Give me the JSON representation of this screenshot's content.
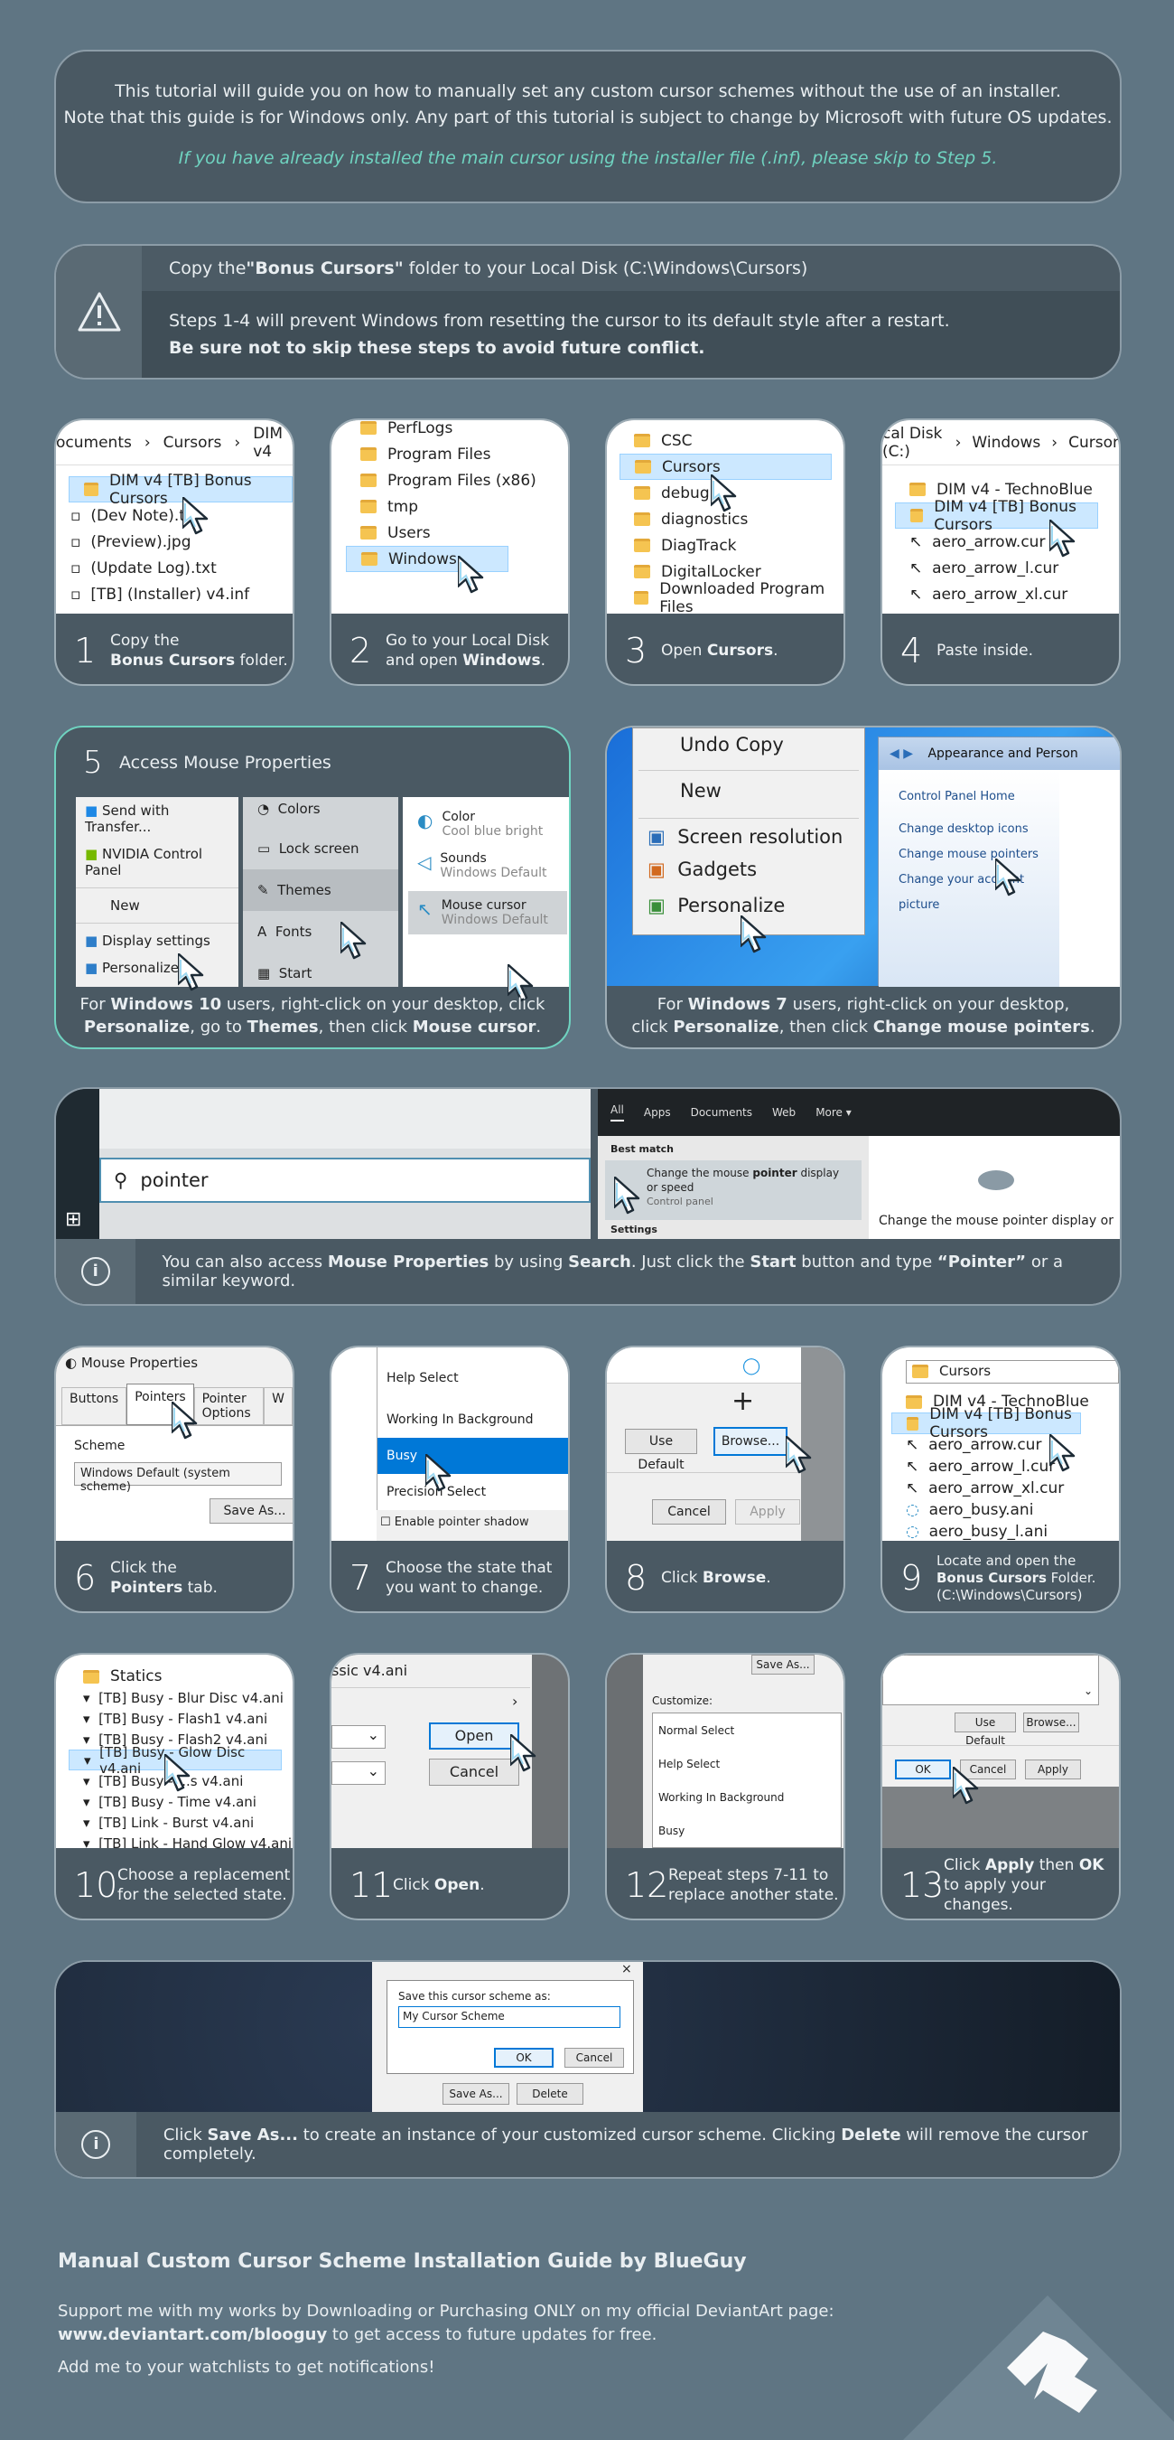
{
  "intro": {
    "line1": "This tutorial will guide you on how to manually set any custom cursor schemes without the use of an installer.",
    "line2": "Note that this guide is for Windows only. Any part of this tutorial is subject to change by Microsoft with future OS updates.",
    "line3": "If you have already installed the main cursor using the installer file (.inf), please skip to Step 5."
  },
  "warning": {
    "pre": "Copy the ",
    "bold": "\"Bonus Cursors\"",
    "post": " folder to your Local Disk (C:\\Windows\\Cursors)",
    "note1": "Steps 1-4 will prevent Windows from resetting the cursor to its default style after a restart.",
    "note2": "Be sure not to skip these steps to avoid future conflict."
  },
  "steps_row1": [
    {
      "num": "1",
      "l1": "Copy the",
      "l2b": "Bonus Cursors",
      "l2": " folder."
    },
    {
      "num": "2",
      "l1": "Go to your Local Disk",
      "l2": "and open ",
      "l2b": "Windows",
      "l2e": "."
    },
    {
      "num": "3",
      "l1": "Open ",
      "l1b": "Cursors",
      "l1e": "."
    },
    {
      "num": "4",
      "l1": "Paste inside."
    }
  ],
  "shot1": {
    "crumbs": [
      "ocuments",
      "Cursors",
      "DIM v4"
    ],
    "items": [
      "DIM v4 [TB] Bonus Cursors",
      "(Dev Note).t",
      "(Preview).jpg",
      "(Update Log).txt",
      "[TB] (Installer) v4.inf"
    ]
  },
  "shot2": {
    "items": [
      "PerfLogs",
      "Program Files",
      "Program Files (x86)",
      "tmp",
      "Users",
      "Windows"
    ]
  },
  "shot3": {
    "items": [
      "CSC",
      "Cursors",
      "debug",
      "diagnostics",
      "DiagTrack",
      "DigitalLocker",
      "Downloaded Program Files"
    ]
  },
  "shot4": {
    "crumbs": [
      "cal Disk (C:)",
      "Windows",
      "Cursor"
    ],
    "items": [
      "DIM v4 - TechnoBlue",
      "DIM v4 [TB] Bonus Cursors",
      "aero_arrow.cur",
      "aero_arrow_l.cur",
      "aero_arrow_xl.cur"
    ]
  },
  "step5": {
    "num": "5",
    "title": "Access Mouse Properties",
    "menu": [
      "Send with Transfer...",
      "NVIDIA Control Panel",
      "New",
      "Display settings",
      "Personalize"
    ],
    "settings": [
      "Colors",
      "Lock screen",
      "Themes",
      "Fonts",
      "Start"
    ],
    "options": [
      {
        "t": "Color",
        "s": "Cool blue bright"
      },
      {
        "t": "Sounds",
        "s": "Windows Default"
      },
      {
        "t": "Mouse cursor",
        "s": "Windows Default"
      }
    ],
    "cap1a": "For ",
    "cap1b": "Windows 10",
    "cap1c": " users, right-click on your desktop, click",
    "cap2a": "Personalize",
    "cap2b": ", go to ",
    "cap2c": "Themes",
    "cap2d": ", then click ",
    "cap2e": "Mouse cursor",
    "cap2f": "."
  },
  "win7": {
    "menu": [
      "Undo Copy",
      "New",
      "Screen resolution",
      "Gadgets",
      "Personalize"
    ],
    "title": "Appearance and Person",
    "links": [
      "Control Panel Home",
      "Change desktop icons",
      "Change mouse pointers",
      "Change your account picture"
    ],
    "cap1a": "For ",
    "cap1b": "Windows 7",
    "cap1c": " users, right-click on your desktop,",
    "cap2a": "click ",
    "cap2b": "Personalize",
    "cap2c": ", then click ",
    "cap2d": "Change mouse pointers",
    "cap2e": "."
  },
  "search": {
    "query": "pointer",
    "tabs": [
      "All",
      "Apps",
      "Documents",
      "Web",
      "More ▾"
    ],
    "best": "Best match",
    "result1": "Change the mouse ",
    "result1b": "pointer",
    "result1c": " display",
    "result2": "or speed",
    "result3": "Control panel",
    "settings": "Settings",
    "right": "Change the mouse pointer display or",
    "tip_a": "You can also access ",
    "tip_b": "Mouse Properties",
    "tip_c": " by using ",
    "tip_d": "Search",
    "tip_e": ". Just click the ",
    "tip_f": "Start",
    "tip_g": " button and type ",
    "tip_h": "“Pointer”",
    "tip_i": " or a similar keyword."
  },
  "steps_row2": [
    {
      "num": "6",
      "l1": "Click the",
      "l2b": "Pointers",
      "l2": " tab."
    },
    {
      "num": "7",
      "l1": "Choose the state that",
      "l2": "you want to change."
    },
    {
      "num": "8",
      "l1": "Click ",
      "l1b": "Browse",
      "l1e": "."
    },
    {
      "num": "9",
      "l1": "Locate and open the",
      "l2b": "Bonus Cursors",
      "l2": " Folder.",
      "l3": "(C:\\Windows\\Cursors)"
    }
  ],
  "shot6": {
    "title": "Mouse Properties",
    "tabs": [
      "Buttons",
      "Pointers",
      "Pointer Options",
      "W"
    ],
    "scheme": "Scheme",
    "select": "Windows Default (system scheme)",
    "save": "Save As..."
  },
  "shot7": {
    "items": [
      "Help Select",
      "Working In Background",
      "Busy",
      "Precision Select"
    ],
    "check": "Enable pointer shadow"
  },
  "shot8": {
    "use": "Use Default",
    "browse": "Browse...",
    "cancel": "Cancel",
    "apply": "Apply"
  },
  "shot9": {
    "path": "Cursors",
    "items": [
      "DIM v4 - TechnoBlue",
      "DIM v4 [TB] Bonus Cursors",
      "aero_arrow.cur",
      "aero_arrow_l.cur",
      "aero_arrow_xl.cur",
      "aero_busy.ani",
      "aero_busy_l.ani"
    ]
  },
  "steps_row3": [
    {
      "num": "10",
      "l1": "Choose a replacement",
      "l2": "for the selected state."
    },
    {
      "num": "11",
      "l1": "Click ",
      "l1b": "Open",
      "l1e": "."
    },
    {
      "num": "12",
      "l1": "Repeat steps 7-11 to",
      "l2": "replace another state."
    },
    {
      "num": "13",
      "l1": "Click ",
      "l1b": "Apply",
      "l1m": " then ",
      "l1c": "OK",
      "l2": "to apply your changes."
    }
  ],
  "shot10": {
    "header": "Statics",
    "items": [
      "[TB] Busy - Blur Disc v4.ani",
      "[TB] Busy - Flash1 v4.ani",
      "[TB] Busy - Flash2 v4.ani",
      "[TB] Busy - Glow Disc v4.ani",
      "[TB] Busy - ...s v4.ani",
      "[TB] Busy - Time v4.ani",
      "[TB] Link - Burst v4.ani",
      "[TB] Link - Hand Glow v4.ani"
    ]
  },
  "shot11": {
    "file": "ssic v4.ani",
    "open": "Open",
    "cancel": "Cancel"
  },
  "shot12": {
    "save": "Save As...",
    "customize": "Customize:",
    "items": [
      "Normal Select",
      "Help Select",
      "Working In Background",
      "Busy"
    ]
  },
  "shot13": {
    "use": "Use Default",
    "browse": "Browse...",
    "ok": "OK",
    "cancel": "Cancel",
    "apply": "Apply"
  },
  "save": {
    "label": "Save this cursor scheme as:",
    "value": "My Cursor Scheme",
    "ok": "OK",
    "cancel": "Cancel",
    "saveas": "Save As...",
    "delete": "Delete",
    "tip_a": "Click ",
    "tip_b": "Save As...",
    "tip_c": " to create an instance of your customized cursor scheme. Clicking ",
    "tip_d": "Delete",
    "tip_e": " will remove the cursor completely."
  },
  "footer": {
    "title": "Manual Custom Cursor Scheme Installation Guide by BlueGuy",
    "p1": "Support me with my works by Downloading or Purchasing ONLY on my official DeviantArt page:",
    "p2b": "www.deviantart.com/blooguy",
    "p2": " to get access to future updates for free.",
    "p3": "Add me to your watchlists to get notifications!"
  },
  "colors": {
    "bg": "#5f7583",
    "card": "#4a5963",
    "accent": "#6fd3c0",
    "selection": "#cce8ff"
  }
}
